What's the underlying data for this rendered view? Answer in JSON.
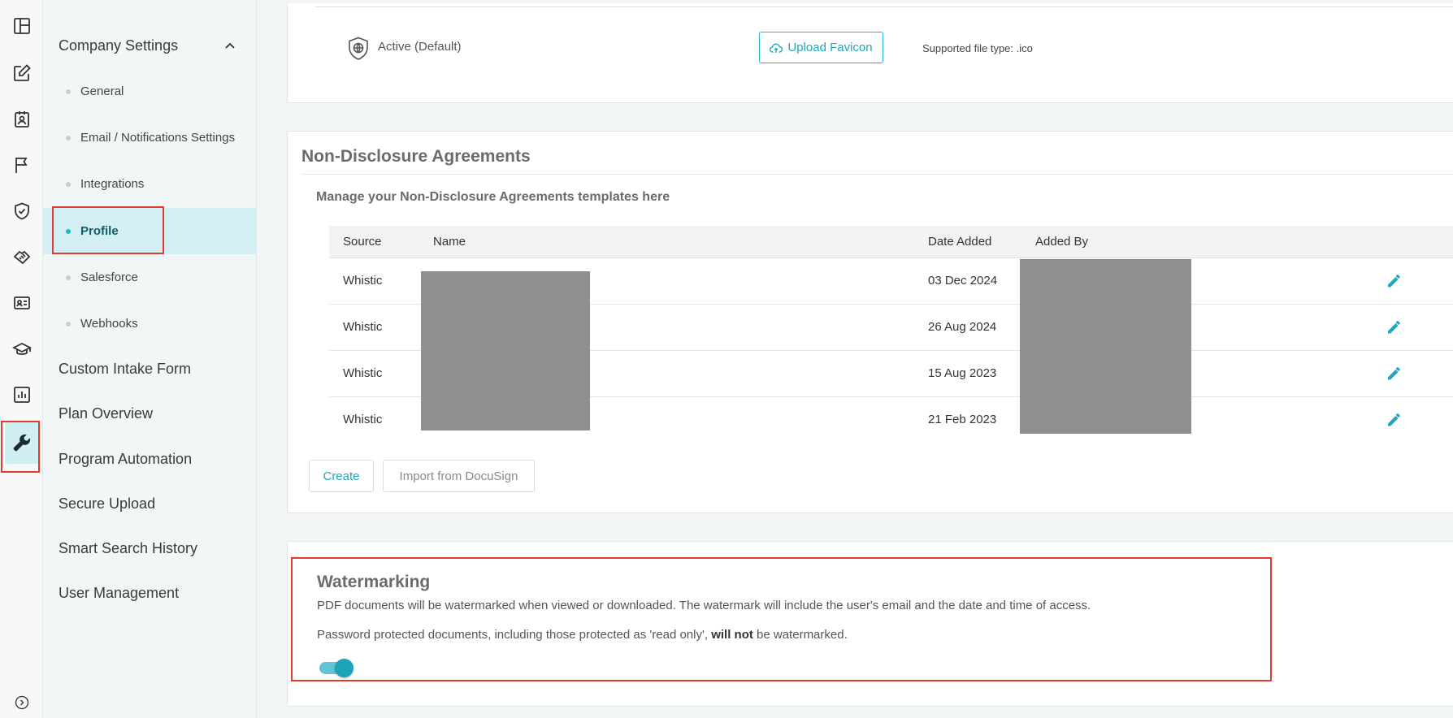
{
  "rail": {
    "icons": [
      "dashboard-icon",
      "edit-icon",
      "contact-icon",
      "flag-icon",
      "shield-check-icon",
      "handshake-icon",
      "id-card-icon",
      "graduation-cap-icon",
      "bar-chart-icon",
      "wrench-icon",
      "expand-icon"
    ],
    "active": "wrench-icon"
  },
  "nav": {
    "group_title": "Company Settings",
    "sub_items": [
      {
        "label": "General"
      },
      {
        "label": "Email / Notifications Settings"
      },
      {
        "label": "Integrations"
      },
      {
        "label": "Profile",
        "active": true
      },
      {
        "label": "Salesforce"
      },
      {
        "label": "Webhooks"
      }
    ],
    "items": [
      {
        "label": "Custom Intake Form"
      },
      {
        "label": "Plan Overview"
      },
      {
        "label": "Program Automation"
      },
      {
        "label": "Secure Upload"
      },
      {
        "label": "Smart Search History"
      },
      {
        "label": "User Management"
      }
    ]
  },
  "favicon": {
    "status": "Active (Default)",
    "upload_label": "Upload Favicon",
    "file_type_note": "Supported file type: .ico"
  },
  "nda": {
    "title": "Non-Disclosure Agreements",
    "subtitle": "Manage your Non-Disclosure Agreements templates here",
    "columns": [
      "Source",
      "Name",
      "Date Added",
      "Added By"
    ],
    "rows": [
      {
        "source": "Whistic",
        "date": "03 Dec 2024"
      },
      {
        "source": "Whistic",
        "date": "26 Aug 2024"
      },
      {
        "source": "Whistic",
        "date": "15 Aug 2023"
      },
      {
        "source": "Whistic",
        "date": "21 Feb 2023"
      }
    ],
    "create_label": "Create",
    "import_label": "Import from DocuSign"
  },
  "watermarking": {
    "title": "Watermarking",
    "description": "PDF documents will be watermarked when viewed or downloaded. The watermark will include the user's email and the date and time of access.",
    "note_prefix": "Password protected documents, including those protected as 'read only',",
    "note_bold": "will not",
    "note_suffix": "be watermarked.",
    "enabled": true
  },
  "colors": {
    "accent": "#1fa6bc",
    "highlight": "#e23b2e",
    "active_bg": "#d3eff3"
  }
}
